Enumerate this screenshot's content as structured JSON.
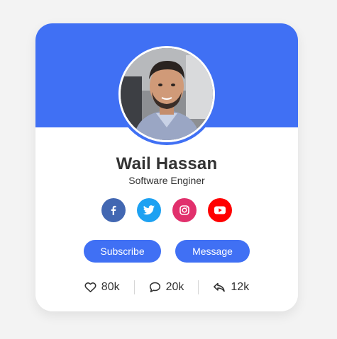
{
  "profile": {
    "name": "Wail Hassan",
    "job": "Software Enginer"
  },
  "socials": [
    {
      "icon": "facebook-icon",
      "color": "#4267b2"
    },
    {
      "icon": "twitter-icon",
      "color": "#1da1f2"
    },
    {
      "icon": "instagram-icon",
      "color": "#e1306c"
    },
    {
      "icon": "youtube-icon",
      "color": "#ff0000"
    }
  ],
  "buttons": {
    "subscribe": "Subscribe",
    "message": "Message"
  },
  "stats": {
    "likes": "80k",
    "comments": "20k",
    "shares": "12k"
  },
  "colors": {
    "accent": "#4070f4",
    "background": "#f3f3f3"
  }
}
